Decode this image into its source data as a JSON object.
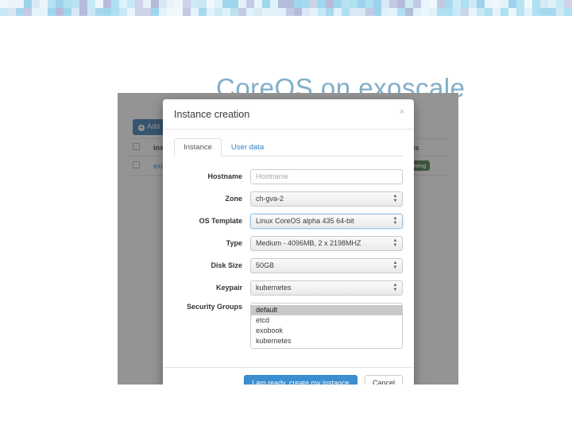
{
  "slide": {
    "title": "CoreOS on exoscale",
    "title_color": "#80aec9"
  },
  "decor": {
    "mosaic_colors": [
      "#cfe9f5",
      "#b8e2f2",
      "#e9f5fb",
      "#a7d9ee",
      "#c3c9e4",
      "#dff1f9",
      "#9ed7ed",
      "#b5bcd9",
      "#e4f2fa",
      "#d8e8f4",
      "#9cd3ec",
      "#cdd3e8",
      "#f0f8fc",
      "#aee0f1",
      "#c7e8f6"
    ]
  },
  "console": {
    "add_button": {
      "label": "Add",
      "icon": "plus-circle-icon",
      "color": "#2f6fad"
    },
    "table": {
      "columns": [
        "",
        "instance name",
        "status"
      ],
      "rows": [
        {
          "checked": false,
          "name": "exobook",
          "status": "Running",
          "status_color": "#3c763d"
        }
      ]
    }
  },
  "modal": {
    "title": "Instance creation",
    "close_label": "×",
    "tabs": [
      {
        "label": "Instance",
        "active": true
      },
      {
        "label": "User data",
        "active": false
      }
    ],
    "fields": {
      "hostname": {
        "label": "Hostname",
        "value": "",
        "placeholder": "Hostname"
      },
      "zone": {
        "label": "Zone",
        "value": "ch-gva-2"
      },
      "os_template": {
        "label": "OS Template",
        "value": "Linux CoreOS alpha 435 64-bit",
        "focused": true
      },
      "type": {
        "label": "Type",
        "value": "Medium - 4096MB, 2 x 2198MHZ"
      },
      "disk_size": {
        "label": "Disk Size",
        "value": "50GB"
      },
      "keypair": {
        "label": "Keypair",
        "value": "kubernetes"
      },
      "security_groups": {
        "label": "Security Groups",
        "options": [
          "default",
          "etcd",
          "exobook",
          "kubernetes"
        ],
        "selected": "default"
      }
    },
    "footer": {
      "submit_label": "I am ready, create my instance",
      "cancel_label": "Cancel",
      "submit_color": "#3b8ed0"
    }
  }
}
